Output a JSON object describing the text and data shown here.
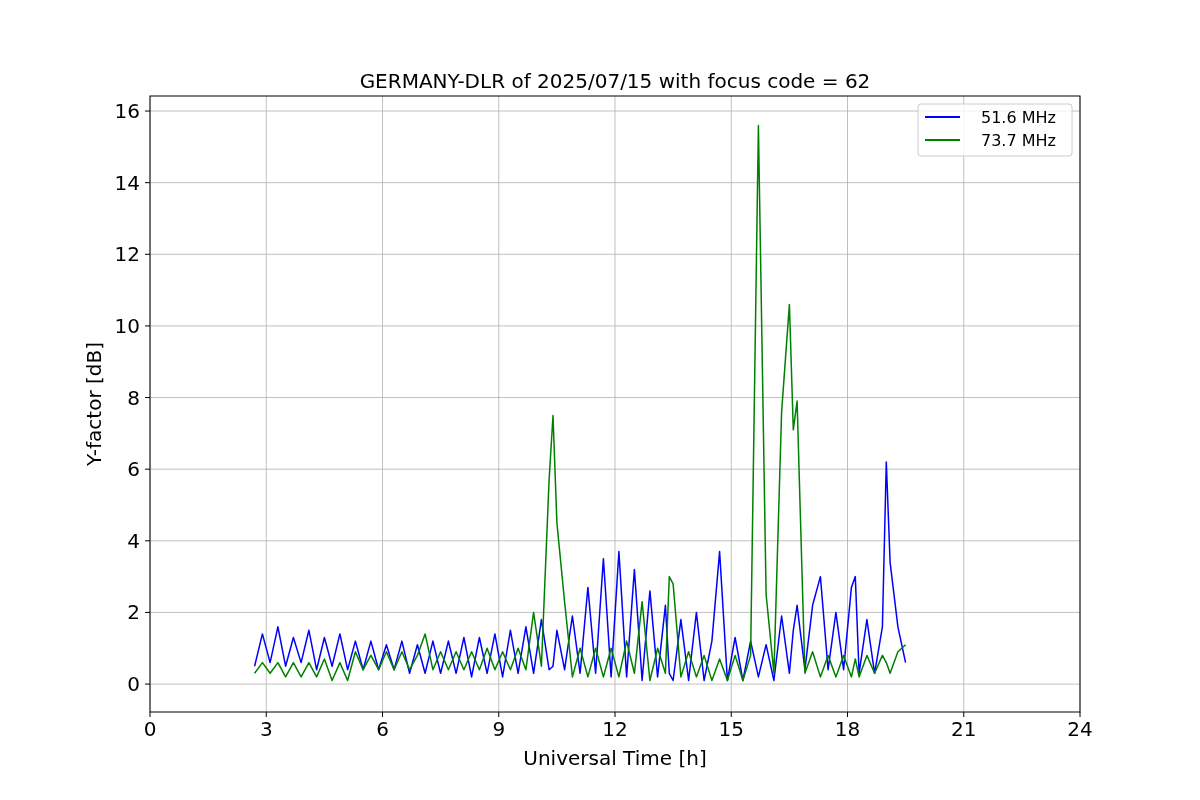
{
  "figure": {
    "chart_data": {
      "type": "line",
      "title": "GERMANY-DLR of 2025/07/15 with focus code = 62",
      "xlabel": "Universal Time [h]",
      "ylabel": "Y-factor [dB]",
      "x": [
        2.7,
        2.9,
        3.1,
        3.3,
        3.5,
        3.7,
        3.9,
        4.1,
        4.3,
        4.5,
        4.7,
        4.9,
        5.1,
        5.3,
        5.5,
        5.7,
        5.9,
        6.1,
        6.3,
        6.5,
        6.7,
        6.9,
        7.1,
        7.3,
        7.5,
        7.7,
        7.9,
        8.1,
        8.3,
        8.5,
        8.7,
        8.9,
        9.1,
        9.3,
        9.5,
        9.7,
        9.9,
        10.1,
        10.3,
        10.4,
        10.5,
        10.7,
        10.9,
        11.1,
        11.3,
        11.5,
        11.7,
        11.9,
        12.1,
        12.3,
        12.5,
        12.7,
        12.9,
        13.1,
        13.3,
        13.4,
        13.5,
        13.7,
        13.9,
        14.1,
        14.3,
        14.5,
        14.7,
        14.9,
        15.1,
        15.3,
        15.5,
        15.7,
        15.9,
        16.1,
        16.3,
        16.5,
        16.6,
        16.7,
        16.9,
        17.1,
        17.3,
        17.5,
        17.7,
        17.9,
        18.1,
        18.2,
        18.3,
        18.5,
        18.7,
        18.9,
        19.0,
        19.1,
        19.3,
        19.5
      ],
      "series": [
        {
          "name": "51.6 MHz",
          "color": "#0000ff",
          "values": [
            0.5,
            1.4,
            0.6,
            1.6,
            0.5,
            1.3,
            0.6,
            1.5,
            0.4,
            1.3,
            0.5,
            1.4,
            0.4,
            1.2,
            0.4,
            1.2,
            0.4,
            1.1,
            0.4,
            1.2,
            0.3,
            1.1,
            0.3,
            1.2,
            0.3,
            1.2,
            0.3,
            1.3,
            0.2,
            1.3,
            0.3,
            1.4,
            0.2,
            1.5,
            0.3,
            1.6,
            0.3,
            1.8,
            0.4,
            0.5,
            1.5,
            0.4,
            1.9,
            0.3,
            2.7,
            0.3,
            3.5,
            0.2,
            3.7,
            0.2,
            3.2,
            0.1,
            2.6,
            0.2,
            2.2,
            0.3,
            0.1,
            1.8,
            0.1,
            2.0,
            0.1,
            1.2,
            3.7,
            0.1,
            1.3,
            0.1,
            1.2,
            0.2,
            1.1,
            0.1,
            1.9,
            0.3,
            1.5,
            2.2,
            0.4,
            2.2,
            3.0,
            0.4,
            2.0,
            0.4,
            2.7,
            3.0,
            0.3,
            1.8,
            0.3,
            1.6,
            6.2,
            3.4,
            1.6,
            0.6
          ]
        },
        {
          "name": "73.7 MHz",
          "color": "#008000",
          "values": [
            0.3,
            0.6,
            0.3,
            0.6,
            0.2,
            0.6,
            0.2,
            0.6,
            0.2,
            0.7,
            0.1,
            0.6,
            0.1,
            0.9,
            0.4,
            0.8,
            0.4,
            0.9,
            0.4,
            0.9,
            0.4,
            0.8,
            1.4,
            0.4,
            0.9,
            0.4,
            0.9,
            0.4,
            0.9,
            0.4,
            1.0,
            0.4,
            0.9,
            0.4,
            1.0,
            0.4,
            2.0,
            0.5,
            5.7,
            7.5,
            4.5,
            2.3,
            0.2,
            1.0,
            0.2,
            1.0,
            0.2,
            1.0,
            0.2,
            1.2,
            0.3,
            2.3,
            0.1,
            1.0,
            0.3,
            3.0,
            2.8,
            0.2,
            0.9,
            0.2,
            0.8,
            0.1,
            0.7,
            0.1,
            0.8,
            0.1,
            0.8,
            15.6,
            2.5,
            0.3,
            7.6,
            10.6,
            7.1,
            7.9,
            0.3,
            0.9,
            0.2,
            0.8,
            0.2,
            0.8,
            0.2,
            0.7,
            0.2,
            0.8,
            0.3,
            0.8,
            0.6,
            0.3,
            0.9,
            1.1
          ]
        }
      ],
      "xlim": [
        0,
        24
      ],
      "ylim": [
        -0.78,
        16.42
      ],
      "xticks": [
        0,
        3,
        6,
        9,
        12,
        15,
        18,
        21,
        24
      ],
      "yticks": [
        0,
        2,
        4,
        6,
        8,
        10,
        12,
        14,
        16
      ],
      "grid": true,
      "legend": true
    }
  }
}
